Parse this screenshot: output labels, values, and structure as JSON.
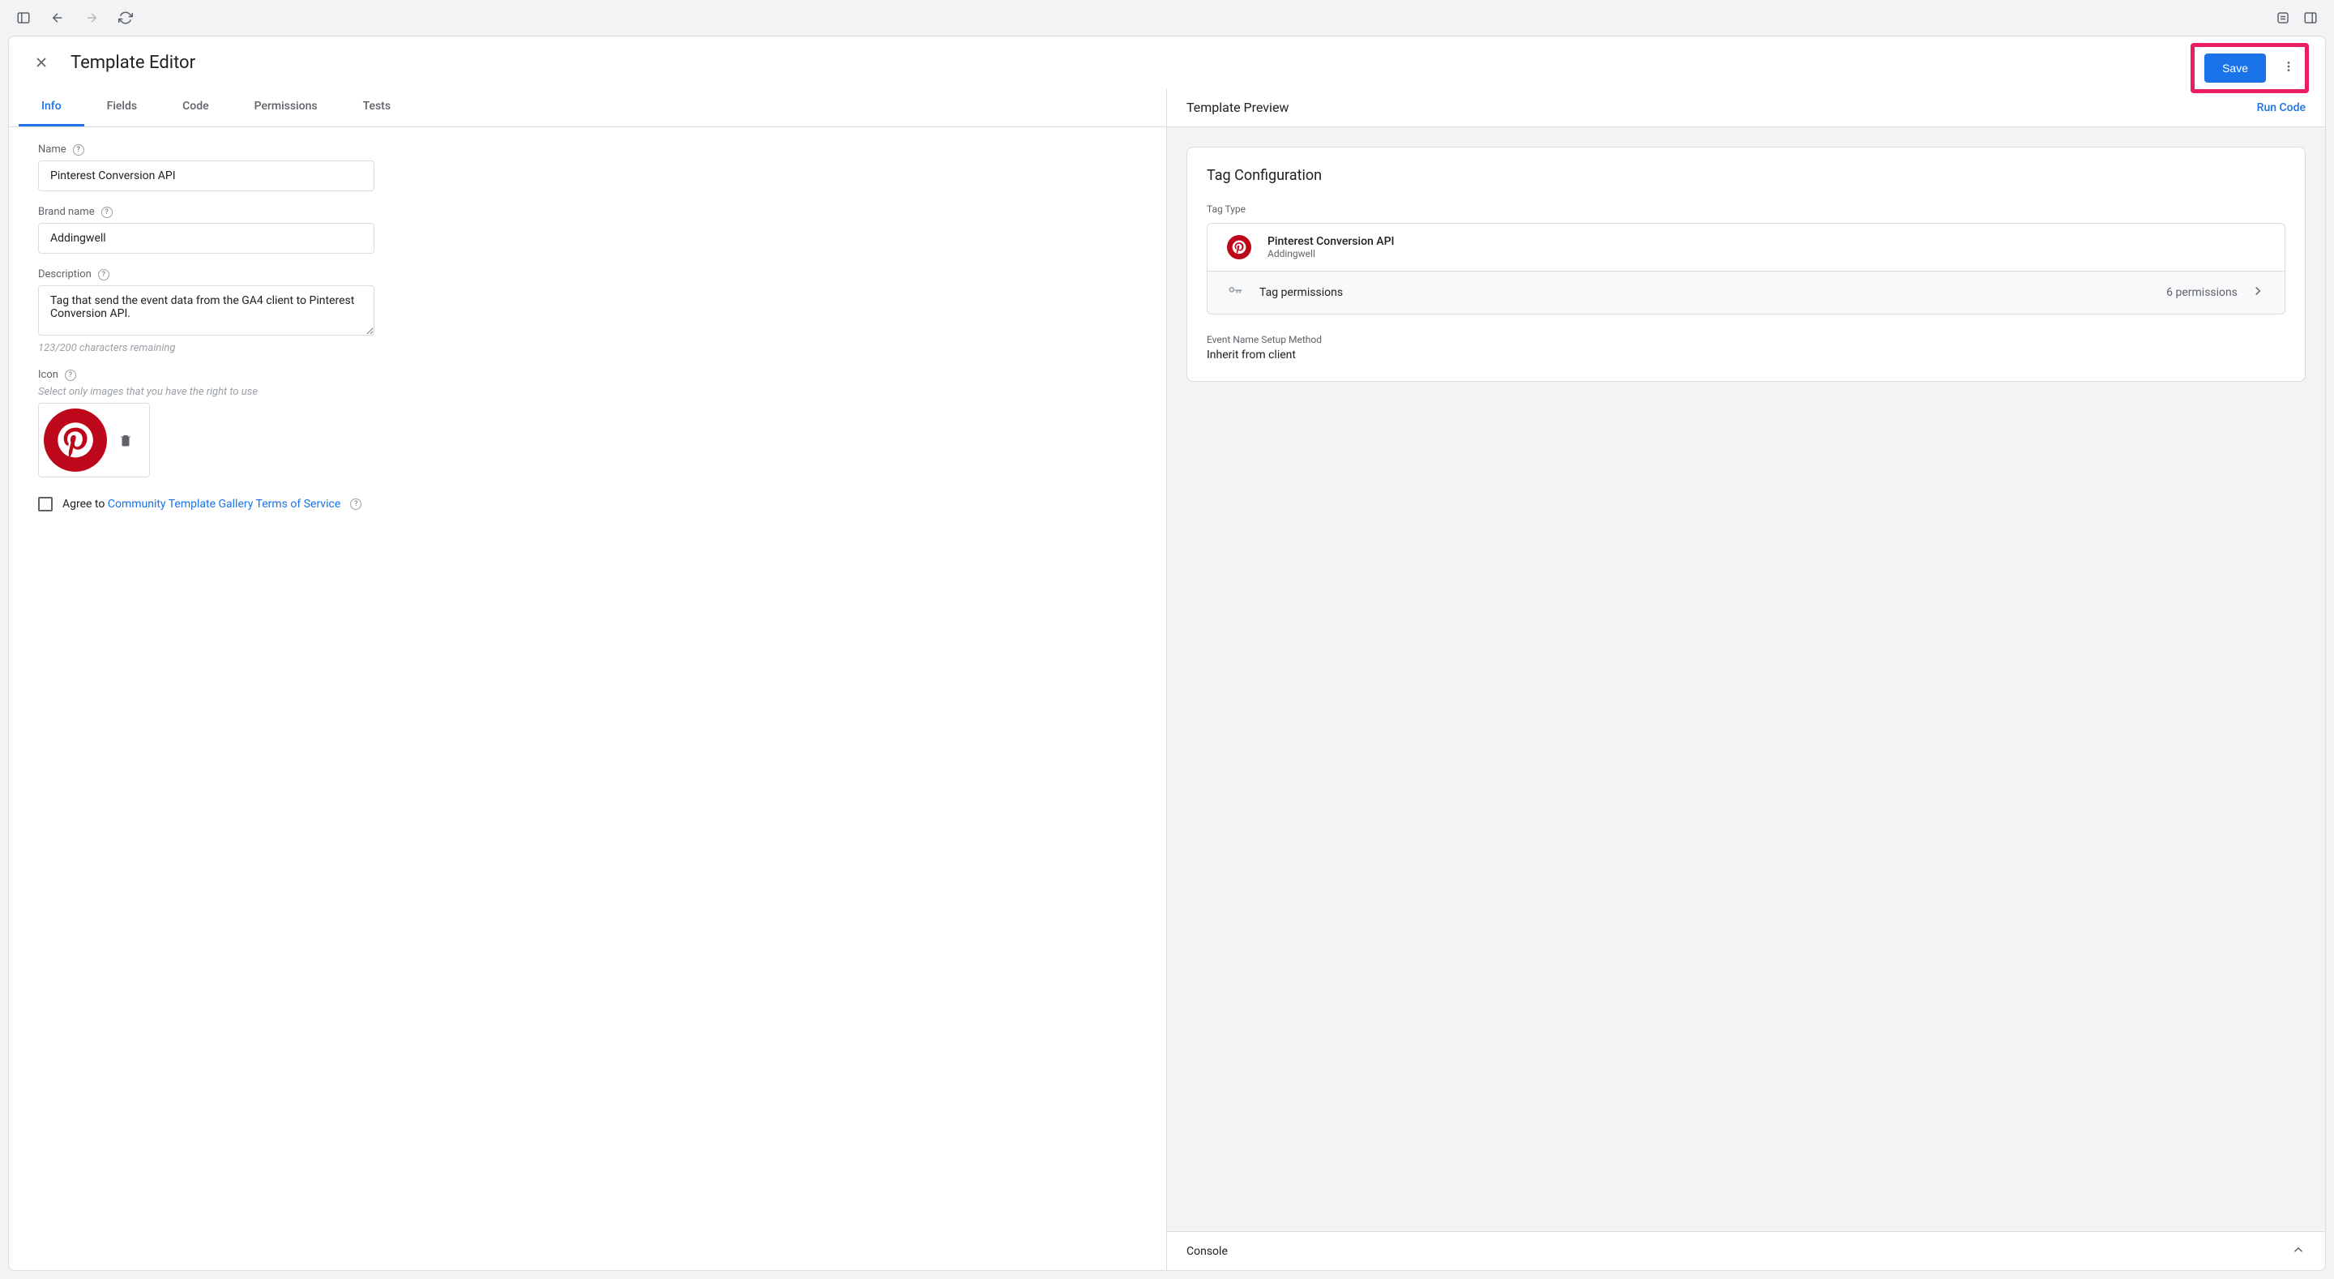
{
  "header": {
    "title": "Template Editor",
    "save_label": "Save"
  },
  "tabs": {
    "info": "Info",
    "fields": "Fields",
    "code": "Code",
    "permissions": "Permissions",
    "tests": "Tests"
  },
  "form": {
    "name_label": "Name",
    "name_value": "Pinterest Conversion API",
    "brand_label": "Brand name",
    "brand_value": "Addingwell",
    "desc_label": "Description",
    "desc_value": "Tag that send the event data from the GA4 client to Pinterest Conversion API.",
    "desc_counter": "123/200 characters remaining",
    "icon_label": "Icon",
    "icon_hint": "Select only images that you have the right to use",
    "agree_prefix": "Agree to ",
    "agree_link": "Community Template Gallery Terms of Service"
  },
  "preview": {
    "title": "Template Preview",
    "run_code": "Run Code",
    "config_title": "Tag Configuration",
    "tag_type_label": "Tag Type",
    "tag_name": "Pinterest Conversion API",
    "tag_brand": "Addingwell",
    "perms_label": "Tag permissions",
    "perms_count": "6 permissions",
    "event_label": "Event Name Setup Method",
    "event_value": "Inherit from client"
  },
  "console": {
    "label": "Console"
  }
}
